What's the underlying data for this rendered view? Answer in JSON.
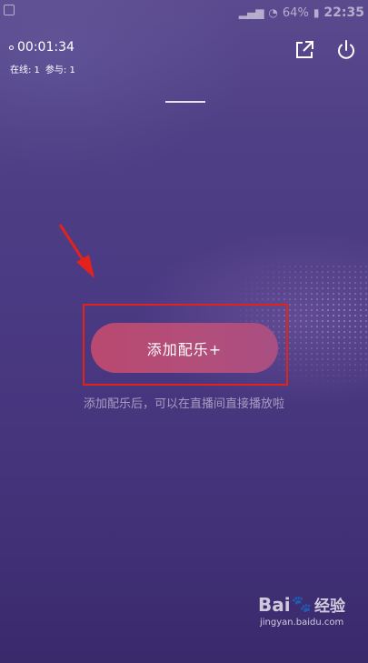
{
  "status_bar": {
    "signal_icon": "signal-icon",
    "wifi_icon": "wifi-icon",
    "battery": "64%",
    "time": "22:35"
  },
  "session": {
    "timer": "00:01:34",
    "online": "在线: 1",
    "participants": "参与: 1"
  },
  "top_actions": {
    "share_icon": "share-icon",
    "power_icon": "power-icon"
  },
  "main": {
    "add_music_button": "添加配乐+",
    "hint": "添加配乐后，可以在直播间直接播放啦"
  },
  "annotations": {
    "arrow_color": "#e3231b",
    "box_color": "#e3231b"
  },
  "watermark": {
    "brand_prefix": "Bai",
    "brand_suffix": "经验",
    "url": "jingyan.baidu.com"
  }
}
